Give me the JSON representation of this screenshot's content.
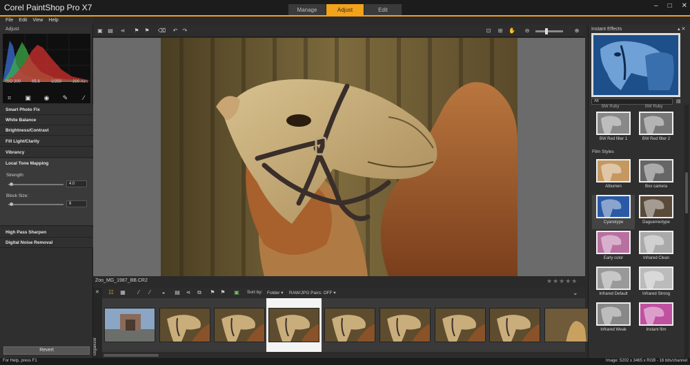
{
  "app": {
    "title": "Corel PaintShop Pro X7",
    "win_controls": [
      "–",
      "□",
      "✕"
    ]
  },
  "mode_tabs": [
    {
      "label": "Manage"
    },
    {
      "label": "Adjust"
    },
    {
      "label": "Edit"
    }
  ],
  "menu": [
    "File",
    "Edit",
    "View",
    "Help"
  ],
  "left_panel": {
    "title": "Adjust",
    "exif": [
      "ISO 200",
      "f/5.6",
      "1/250",
      "200 mm"
    ],
    "sections": [
      "Smart Photo Fix",
      "White Balance",
      "Brightness/Contrast",
      "Fill Light/Clarity",
      "Vibrancy",
      "Local Tone Mapping"
    ],
    "ltm": {
      "strength_label": "Strength:",
      "strength_value": "4.0",
      "strength_level": 0.03,
      "block_label": "Block Size:",
      "block_value": "8",
      "block_level": 0.03
    },
    "sections_after": [
      "High Pass Sharpen",
      "Digital Noise Removal"
    ],
    "revert_label": "Revert"
  },
  "file": {
    "name": "Zoo_MG_1987_BB.CR2",
    "stars": "★★★★★"
  },
  "organizer": {
    "side_label": "Organizer",
    "sort_label": "Sort by:",
    "sort_value": "Folder",
    "raw_pairs": "RAW/JPG Pairs: OFF",
    "thumb_count": 9,
    "selected_index": 3
  },
  "status": {
    "left": "For Help, press F1",
    "right": "Image: 5202 x 3465 x RGB - 16 bits/channel"
  },
  "right_panel": {
    "title": "Instant Effects",
    "filter": "All",
    "partial_labels": [
      "BW Ruby",
      "BW Ruby"
    ],
    "bw_effects": [
      "BW Red filter 1",
      "BW Red filter 2"
    ],
    "film_styles_label": "Film Styles",
    "effects": [
      "Albumen",
      "Box camera",
      "Cyanotype",
      "Daguerreotype",
      "Early color",
      "Infrared Clean",
      "Infrared Default",
      "Infrared Strong",
      "Infrared Weak",
      "Instant film"
    ],
    "selected_effect": "Cyanotype"
  },
  "colors": {
    "accent": "#f2a21b",
    "panel": "#2f2f2f",
    "canvas": "#6b6b6b"
  }
}
